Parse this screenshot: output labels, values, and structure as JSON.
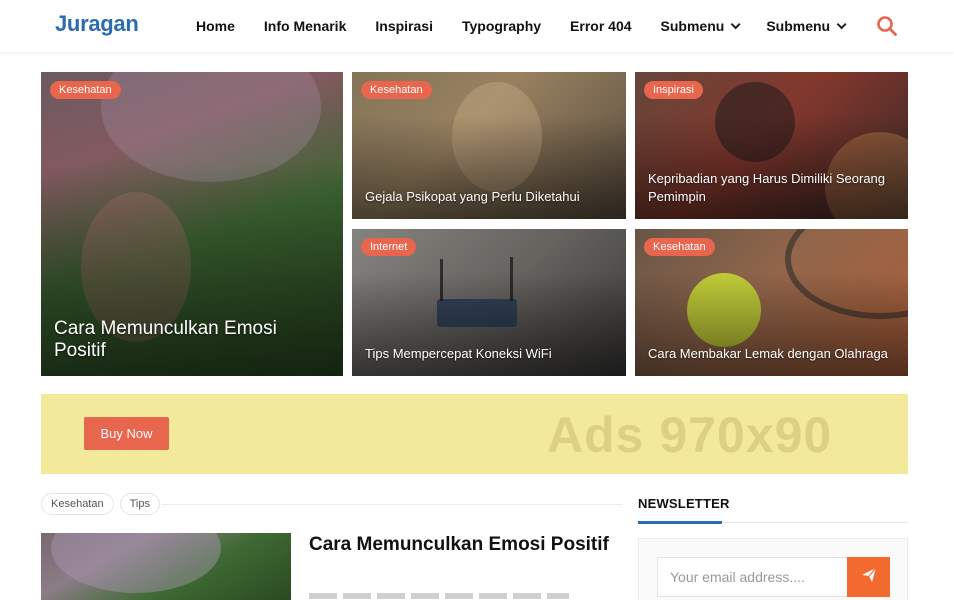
{
  "header": {
    "logo": "Juragan",
    "nav": [
      {
        "label": "Home"
      },
      {
        "label": "Info Menarik"
      },
      {
        "label": "Inspirasi"
      },
      {
        "label": "Typography"
      },
      {
        "label": "Error 404"
      },
      {
        "label": "Submenu"
      },
      {
        "label": "Submenu"
      }
    ],
    "search_icon": "search-icon",
    "accent_color": "#e8654e"
  },
  "featured": [
    {
      "category": "Kesehatan",
      "title": "Cara Memunculkan Emosi Positif"
    },
    {
      "category": "Kesehatan",
      "title": "Gejala Psikopat yang Perlu Diketahui"
    },
    {
      "category": "Inspirasi",
      "title": "Kepribadian yang Harus Dimiliki Seorang Pemimpin"
    },
    {
      "category": "Internet",
      "title": "Tips Mempercepat Koneksi WiFi"
    },
    {
      "category": "Kesehatan",
      "title": "Cara Membakar Lemak dengan Olahraga"
    }
  ],
  "ad": {
    "button_label": "Buy Now",
    "text": "Ads 970x90",
    "background": "#f3e99a"
  },
  "post": {
    "tags": [
      "Kesehatan",
      "Tips"
    ],
    "title": "Cara Memunculkan Emosi Positif"
  },
  "newsletter": {
    "heading": "NEWSLETTER",
    "placeholder": "Your email address....",
    "send_icon": "paper-plane-icon",
    "accent_color": "#f26a2e"
  }
}
